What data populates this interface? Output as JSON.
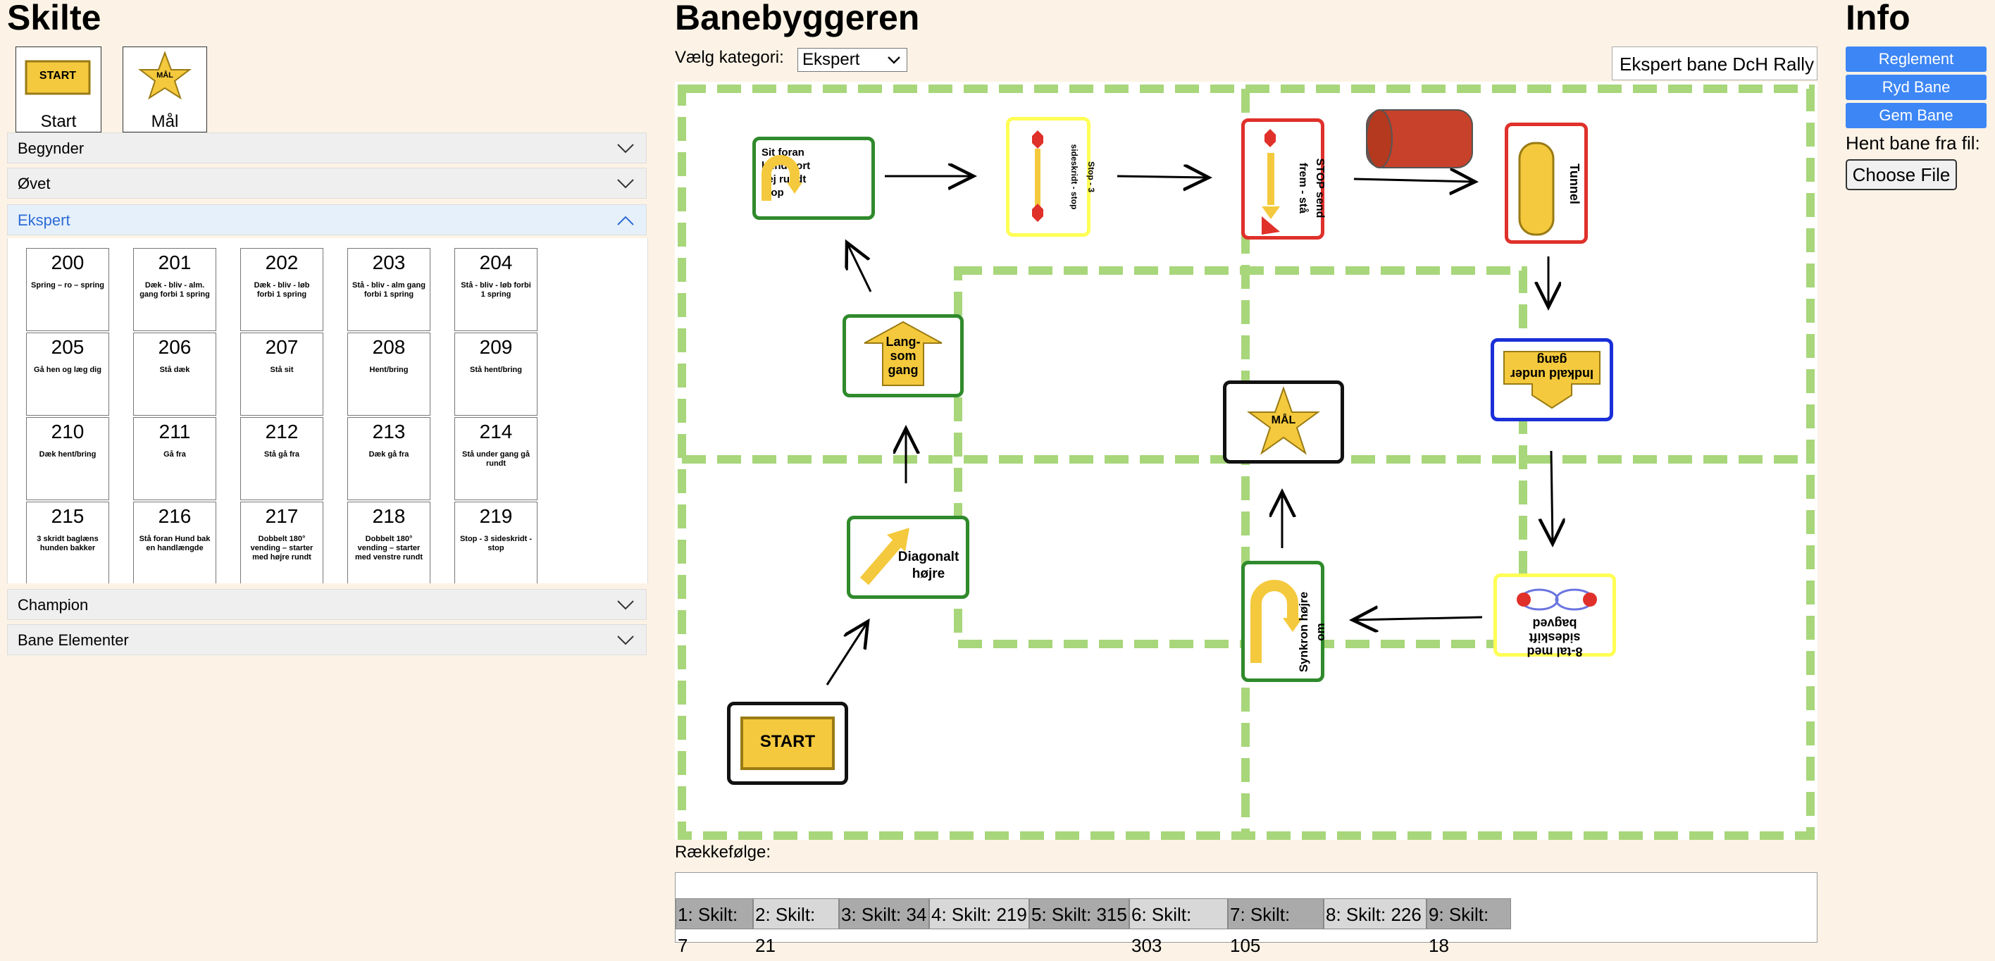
{
  "left": {
    "title": "Skilte",
    "palette": [
      {
        "label": "Start",
        "card_text": "START"
      },
      {
        "label": "Mål",
        "card_text": "MÅL"
      }
    ],
    "sections": [
      {
        "label": "Begynder",
        "open": false
      },
      {
        "label": "Øvet",
        "open": false
      },
      {
        "label": "Ekspert",
        "open": true
      },
      {
        "label": "Champion",
        "open": false
      },
      {
        "label": "Bane Elementer",
        "open": false
      }
    ],
    "signs": [
      {
        "num": "200",
        "text": "Spring – ro – spring"
      },
      {
        "num": "201",
        "text": "Dæk - bliv - alm. gang forbi 1 spring"
      },
      {
        "num": "202",
        "text": "Dæk - bliv - løb forbi 1 spring"
      },
      {
        "num": "203",
        "text": "Stå - bliv - alm gang forbi 1 spring"
      },
      {
        "num": "204",
        "text": "Stå - bliv - løb forbi 1 spring"
      },
      {
        "num": "205",
        "text": "Gå hen og læg dig"
      },
      {
        "num": "206",
        "text": "Stå dæk"
      },
      {
        "num": "207",
        "text": "Stå sit"
      },
      {
        "num": "208",
        "text": "Hent/bring"
      },
      {
        "num": "209",
        "text": "Stå hent/bring"
      },
      {
        "num": "210",
        "text": "Dæk hent/bring"
      },
      {
        "num": "211",
        "text": "Gå fra"
      },
      {
        "num": "212",
        "text": "Stå gå fra"
      },
      {
        "num": "213",
        "text": "Dæk gå fra"
      },
      {
        "num": "214",
        "text": "Stå under gang gå rundt"
      },
      {
        "num": "215",
        "text": "3 skridt baglæns hunden bakker"
      },
      {
        "num": "216",
        "text": "Stå foran Hund bak en handlængde"
      },
      {
        "num": "217",
        "text": "Dobbelt 180° vending – starter med højre rundt"
      },
      {
        "num": "218",
        "text": "Dobbelt 180° vending – starter med venstre rundt"
      },
      {
        "num": "219",
        "text": "Stop - 3 sideskridt - stop"
      }
    ]
  },
  "middle": {
    "title": "Banebyggeren",
    "category_label": "Vælg kategori:",
    "category_value": "Ekspert",
    "course_name": "Ekspert bane DcH Rally",
    "board_signs": {
      "sit": "Sit foran hund kort vej rundt stop",
      "stop3": "Stop - 3 sideskridt - stop",
      "stopsend": "STOP send frem - stå",
      "tunnel": "Tunnel",
      "langsom": "Lang-som gang",
      "indkald": "Indkald under gang",
      "maal": "MÅL",
      "diagonalt": "Diagonalt højre",
      "synkron": "Synkron højre om",
      "ottetal": "8-tal med sideskift bagved",
      "start": "START"
    },
    "order_label": "Rækkefølge:",
    "order": [
      "1: Skilt: 7",
      "2: Skilt: 21",
      "3: Skilt: 34",
      "4: Skilt: 219",
      "5: Skilt: 315",
      "6: Skilt: 303",
      "7: Skilt: 105",
      "8: Skilt: 226",
      "9: Skilt: 18"
    ]
  },
  "right": {
    "title": "Info",
    "buttons": [
      "Reglement",
      "Ryd Bane",
      "Gem Bane"
    ],
    "file_label": "Hent bane fra fil:",
    "file_button": "Choose File"
  },
  "colors": {
    "background": "#fcf3e6",
    "button_blue": "#3d86f5",
    "grid_green": "#a8d67a",
    "sign_yellow": "#f4c93d",
    "border_green": "#2f8a2b",
    "border_red": "#e0302a",
    "border_blue": "#1a2fd8",
    "border_yellow": "#ffff55"
  }
}
